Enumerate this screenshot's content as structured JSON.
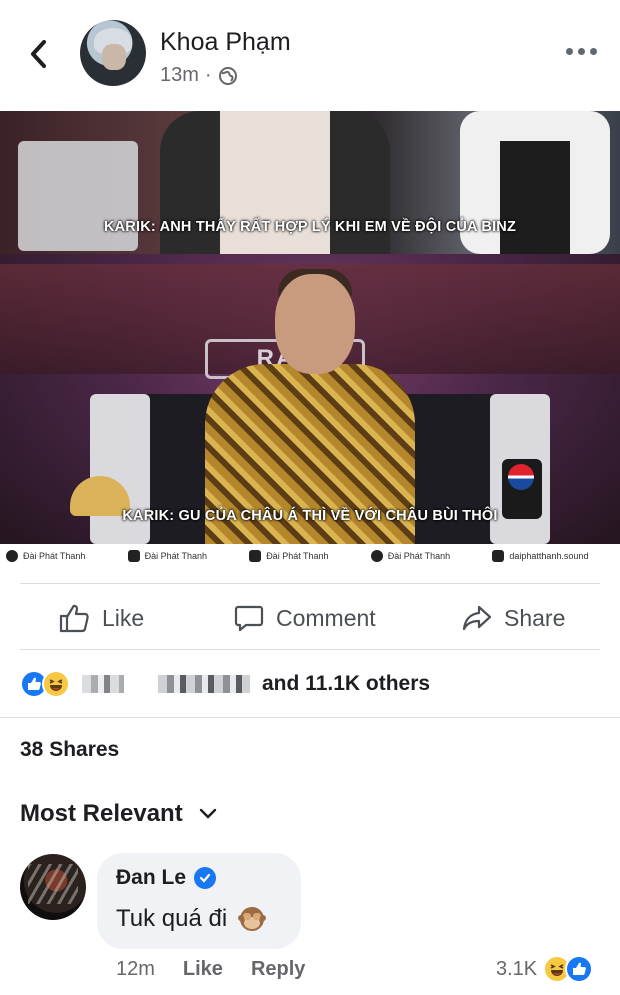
{
  "post": {
    "author": "Khoa Phạm",
    "time": "13m",
    "separator": "·",
    "privacy_icon": "globe-icon"
  },
  "image": {
    "caption_top": "KARIK: ANH THẤY RẤT HỢP LÝ KHI EM VỀ ĐỘI CỦA BINZ",
    "caption_bottom": "KARIK: GU CỦA CHÂU Á THÌ VỀ VỚI CHÂU BÙI THÔI",
    "stage_logo": "RAP",
    "credits": [
      "Đài Phát Thanh",
      "Đài Phát Thanh",
      "Đài Phát Thanh",
      "Đài Phát Thanh",
      "daiphatthanh.sound"
    ]
  },
  "actions": {
    "like": "Like",
    "comment": "Comment",
    "share": "Share"
  },
  "reactions": {
    "summary": "and 11.1K others",
    "types": [
      "like",
      "haha"
    ]
  },
  "shares": "38 Shares",
  "sort": {
    "label": "Most Relevant"
  },
  "comment": {
    "author": "Đan Le",
    "verified": true,
    "text": "Tuk quá đi",
    "time": "12m",
    "like_label": "Like",
    "reply_label": "Reply",
    "reaction_count": "3.1K"
  },
  "colors": {
    "accent": "#1877f2",
    "haha": "#f7c842",
    "text": "#1c1e21",
    "secondary": "#65676b"
  }
}
